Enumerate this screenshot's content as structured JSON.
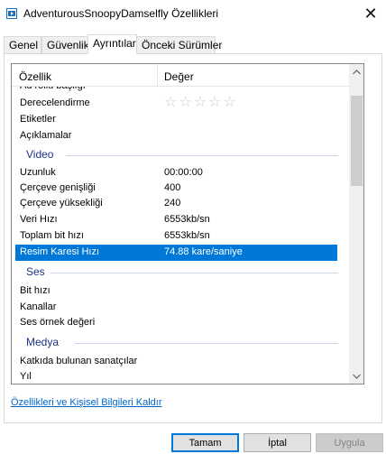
{
  "window": {
    "title": "AdventurousSnoopyDamselfly Özellikleri",
    "close_glyph": "✕",
    "app_icon": "video-file-icon"
  },
  "tabs": [
    {
      "label": "Genel",
      "active": false
    },
    {
      "label": "Güvenlik",
      "active": false
    },
    {
      "label": "Ayrıntılar",
      "active": true
    },
    {
      "label": "Önceki Sürümler",
      "active": false
    }
  ],
  "list": {
    "columns": {
      "property": "Özellik",
      "value": "Değer"
    },
    "rows": {
      "partial": {
        "key": "Ad rollü başlığı",
        "value": ""
      },
      "rating": {
        "key": "Derecelendirme",
        "stars": 5,
        "filled": 0
      },
      "tags": {
        "key": "Etiketler",
        "value": ""
      },
      "comments": {
        "key": "Açıklamalar",
        "value": ""
      },
      "duration": {
        "key": "Uzunluk",
        "value": "00:00:00"
      },
      "frame_width": {
        "key": "Çerçeve genişliği",
        "value": "400"
      },
      "frame_height": {
        "key": "Çerçeve yüksekliği",
        "value": "240"
      },
      "data_rate": {
        "key": "Veri Hızı",
        "value": "6553kb/sn"
      },
      "total_bitrate": {
        "key": "Toplam bit hızı",
        "value": "6553kb/sn"
      },
      "frame_rate": {
        "key": "Resim Karesi Hızı",
        "value": "74.88 kare/saniye"
      },
      "bit_rate": {
        "key": "Bit hızı",
        "value": ""
      },
      "channels": {
        "key": "Kanallar",
        "value": ""
      },
      "sample_rate": {
        "key": "Ses örnek değeri",
        "value": ""
      },
      "contributing_artists": {
        "key": "Katkıda bulunan sanatçılar",
        "value": ""
      },
      "year": {
        "key": "Yıl",
        "value": ""
      }
    },
    "groups": {
      "video": "Video",
      "audio": "Ses",
      "media": "Medya"
    },
    "selected_row": "frame_rate"
  },
  "remove_link": "Özellikleri ve Kişisel Bilgileri Kaldır",
  "buttons": {
    "ok": "Tamam",
    "cancel": "İptal",
    "apply": "Uygula"
  },
  "colors": {
    "selection": "#0078d7",
    "group_label": "#1e3287",
    "link": "#0066cc"
  }
}
